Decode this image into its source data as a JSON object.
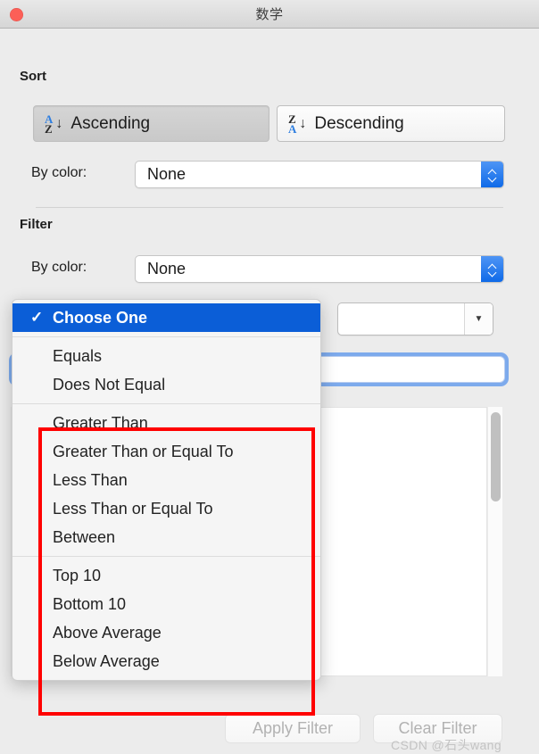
{
  "window": {
    "title": "数学",
    "close_icon": "close-traffic-light"
  },
  "sort": {
    "heading": "Sort",
    "ascending_label": "Ascending",
    "descending_label": "Descending",
    "ascending_glyph_top": "A",
    "ascending_glyph_bottom": "Z",
    "descending_glyph_top": "Z",
    "descending_glyph_bottom": "A",
    "arrow_glyph": "↓",
    "by_color_label": "By color:",
    "by_color_value": "None"
  },
  "filter": {
    "heading": "Filter",
    "by_color_label": "By color:",
    "by_color_value": "None",
    "condition_value": "",
    "value_combo_value": "",
    "combo_arrow_glyph": "▼",
    "search_value": ""
  },
  "dropdown": {
    "selected": "Choose One",
    "check_glyph": "✓",
    "groups": [
      {
        "items": [
          "Choose One"
        ]
      },
      {
        "items": [
          "Equals",
          "Does Not Equal"
        ]
      },
      {
        "items": [
          "Greater Than",
          "Greater Than or Equal To",
          "Less Than",
          "Less Than or Equal To",
          "Between"
        ]
      },
      {
        "items": [
          "Top 10",
          "Bottom 10",
          "Above Average",
          "Below Average"
        ]
      }
    ]
  },
  "footer": {
    "apply_label": "Apply Filter",
    "clear_label": "Clear Filter"
  },
  "watermark": {
    "text": "CSDN @石头wang"
  },
  "colors": {
    "accent_blue": "#0b5ed7",
    "stepper_blue": "#0f6ae8",
    "focus_ring": "#7daaec",
    "highlight_red": "#ff0000",
    "close_red": "#fc5f57"
  }
}
